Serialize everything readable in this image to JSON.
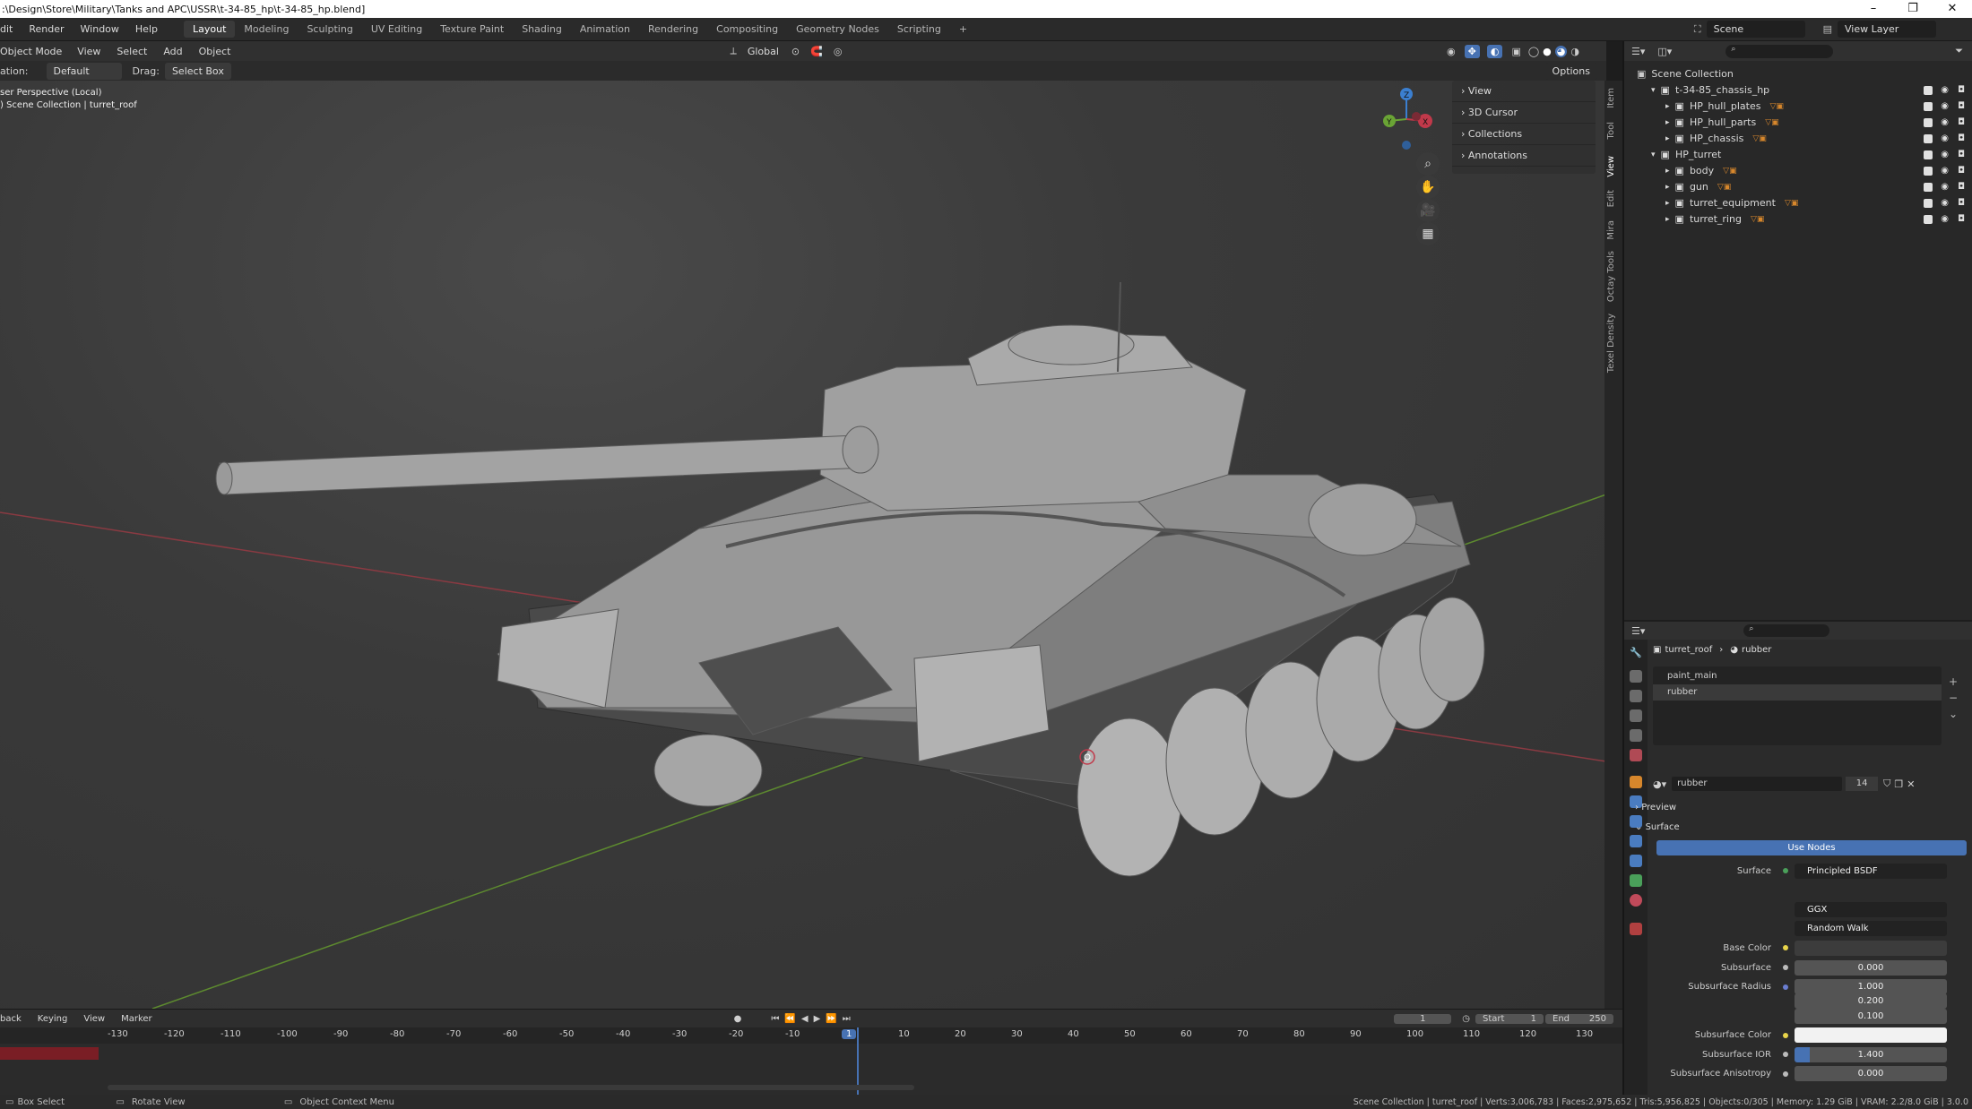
{
  "window": {
    "title": ":\\Design\\Store\\Military\\Tanks and APC\\USSR\\t-34-85_hp\\t-34-85_hp.blend]",
    "controls": [
      "–",
      "❐",
      "✕"
    ]
  },
  "menubar": {
    "menus": [
      "dit",
      "Render",
      "Window",
      "Help"
    ],
    "workspaces": [
      "Layout",
      "Modeling",
      "Sculpting",
      "UV Editing",
      "Texture Paint",
      "Shading",
      "Animation",
      "Rendering",
      "Compositing",
      "Geometry Nodes",
      "Scripting"
    ],
    "active_workspace": "Layout",
    "add_tab": "+",
    "scene_label": "Scene",
    "view_layer_label": "View Layer"
  },
  "viewport_header": {
    "mode": "Object Mode",
    "menus": [
      "View",
      "Select",
      "Add",
      "Object"
    ],
    "transform": "Global",
    "orientation_label": "ation:",
    "orientation_value": "Default",
    "drag_label": "Drag:",
    "drag_value": "Select Box",
    "options": "Options"
  },
  "viewport": {
    "perspective": "ser Perspective (Local)",
    "collection": ") Scene Collection | turret_roof",
    "axis_labels": [
      "X",
      "Y",
      "Z"
    ]
  },
  "n_panel": {
    "items": [
      "View",
      "3D Cursor",
      "Collections",
      "Annotations"
    ]
  },
  "side_tabs": [
    "Item",
    "Tool",
    "View",
    "Edit",
    "Mira",
    "Octay Tools",
    "Texel Density"
  ],
  "outliner": {
    "root": "Scene Collection",
    "items": [
      {
        "label": "t-34-85_chassis_hp",
        "level": 1,
        "expanded": true
      },
      {
        "label": "HP_hull_plates",
        "level": 2
      },
      {
        "label": "HP_hull_parts",
        "level": 2
      },
      {
        "label": "HP_chassis",
        "level": 2
      },
      {
        "label": "HP_turret",
        "level": 1,
        "expanded": true
      },
      {
        "label": "body",
        "level": 2
      },
      {
        "label": "gun",
        "level": 2
      },
      {
        "label": "turret_equipment",
        "level": 2
      },
      {
        "label": "turret_ring",
        "level": 2
      }
    ]
  },
  "properties": {
    "breadcrumb_object": "turret_roof",
    "breadcrumb_material": "rubber",
    "slots": [
      "paint_main",
      "rubber"
    ],
    "material_name": "rubber",
    "material_users": "14",
    "sections": [
      "Preview",
      "Surface"
    ],
    "use_nodes": "Use Nodes",
    "fields": [
      {
        "label": "Surface",
        "value": "Principled BSDF"
      },
      {
        "label": "",
        "value": "GGX"
      },
      {
        "label": "",
        "value": "Random Walk"
      },
      {
        "label": "Base Color",
        "value": ""
      },
      {
        "label": "Subsurface",
        "value": "0.000"
      },
      {
        "label": "Subsurface Radius",
        "value": "1.000"
      },
      {
        "label": "",
        "value": "0.200"
      },
      {
        "label": "",
        "value": "0.100"
      },
      {
        "label": "Subsurface Color",
        "value": ""
      },
      {
        "label": "Subsurface IOR",
        "value": "1.400"
      },
      {
        "label": "Subsurface Anisotropy",
        "value": "0.000"
      }
    ]
  },
  "timeline": {
    "menus": [
      "back",
      "Keying",
      "View",
      "Marker"
    ],
    "current_frame": "1",
    "start_label": "Start",
    "start": "1",
    "end_label": "End",
    "end": "250",
    "ticks": [
      "-130",
      "-120",
      "-110",
      "-100",
      "-90",
      "-80",
      "-70",
      "-60",
      "-50",
      "-40",
      "-30",
      "-20",
      "-10",
      "1",
      "10",
      "20",
      "30",
      "40",
      "50",
      "60",
      "70",
      "80",
      "90",
      "100",
      "110",
      "120",
      "130"
    ]
  },
  "statusbar": {
    "left": [
      "Box Select",
      "Rotate View",
      "Object Context Menu"
    ],
    "right": "Scene Collection | turret_roof | Verts:3,006,783 | Faces:2,975,652 | Tris:5,956,825 | Objects:0/305 | Memory: 1.29 GiB | VRAM: 2.2/8.0 GiB | 3.0.0"
  },
  "colors": {
    "accent": "#4772b3",
    "bg": "#303030",
    "x_axis": "#c0394a",
    "y_axis": "#6aa435",
    "z_axis": "#3b7fd0"
  }
}
